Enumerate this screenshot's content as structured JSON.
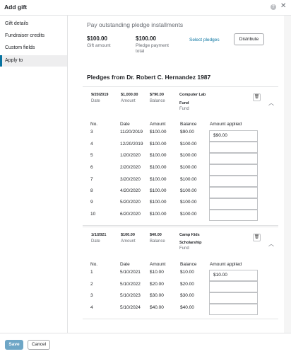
{
  "window": {
    "title": "Add gift",
    "help_icon": "?",
    "close_icon": "✕"
  },
  "sidebar": {
    "items": [
      {
        "label": "Gift details"
      },
      {
        "label": "Fundraiser credits"
      },
      {
        "label": "Custom fields"
      },
      {
        "label": "Apply to",
        "active": true
      }
    ]
  },
  "summary": {
    "heading": "Pay outstanding pledge installments",
    "gift_amount_value": "$100.00",
    "gift_amount_label": "Gift amount",
    "pledge_total_value": "$100.00",
    "pledge_total_label_1": "Pledge payment",
    "pledge_total_label_2": "total",
    "select_pledges_link": "Select pledges",
    "distribute_button": "Distribute"
  },
  "pledges_heading": "Pledges from Dr. Robert C. Hernandez 1987",
  "pledges": [
    {
      "date_value": "9/20/2019",
      "date_label": "Date",
      "amount_value": "$1,000.00",
      "amount_label": "Amount",
      "balance_value": "$790.00",
      "balance_label": "Balance",
      "fund_line_1": "Computer Lab",
      "fund_line_2": "Fund",
      "fund_label": "Fund",
      "columns": [
        "No.",
        "Date",
        "Amount",
        "Balance",
        "Amount applied"
      ],
      "rows": [
        [
          "3",
          "11/20/2019",
          "$100.00",
          "$90.00",
          "$90.00"
        ],
        [
          "4",
          "12/20/2019",
          "$100.00",
          "$100.00",
          ""
        ],
        [
          "5",
          "1/20/2020",
          "$100.00",
          "$100.00",
          ""
        ],
        [
          "6",
          "2/20/2020",
          "$100.00",
          "$100.00",
          ""
        ],
        [
          "7",
          "3/20/2020",
          "$100.00",
          "$100.00",
          ""
        ],
        [
          "8",
          "4/20/2020",
          "$100.00",
          "$100.00",
          ""
        ],
        [
          "9",
          "5/20/2020",
          "$100.00",
          "$100.00",
          ""
        ],
        [
          "10",
          "6/20/2020",
          "$100.00",
          "$100.00",
          ""
        ]
      ]
    },
    {
      "date_value": "1/1/2021",
      "date_label": "Date",
      "amount_value": "$100.00",
      "amount_label": "Amount",
      "balance_value": "$40.00",
      "balance_label": "Balance",
      "fund_line_1": "Camp Kids",
      "fund_line_2": "Scholarship",
      "fund_label": "Fund",
      "columns": [
        "No.",
        "Date",
        "Amount",
        "Balance",
        "Amount applied"
      ],
      "rows": [
        [
          "1",
          "5/10/2021",
          "$10.00",
          "$10.00",
          "$10.00"
        ],
        [
          "2",
          "5/10/2022",
          "$20.00",
          "$20.00",
          ""
        ],
        [
          "3",
          "5/10/2023",
          "$30.00",
          "$30.00",
          ""
        ],
        [
          "4",
          "5/10/2024",
          "$40.00",
          "$40.00",
          ""
        ]
      ]
    }
  ],
  "footer": {
    "save_label": "Save",
    "cancel_label": "Cancel"
  },
  "colors": {
    "accent": "#0974a1",
    "save_button": "#6ea6c6",
    "border": "#e2e3e4",
    "muted_text": "#686c73"
  }
}
